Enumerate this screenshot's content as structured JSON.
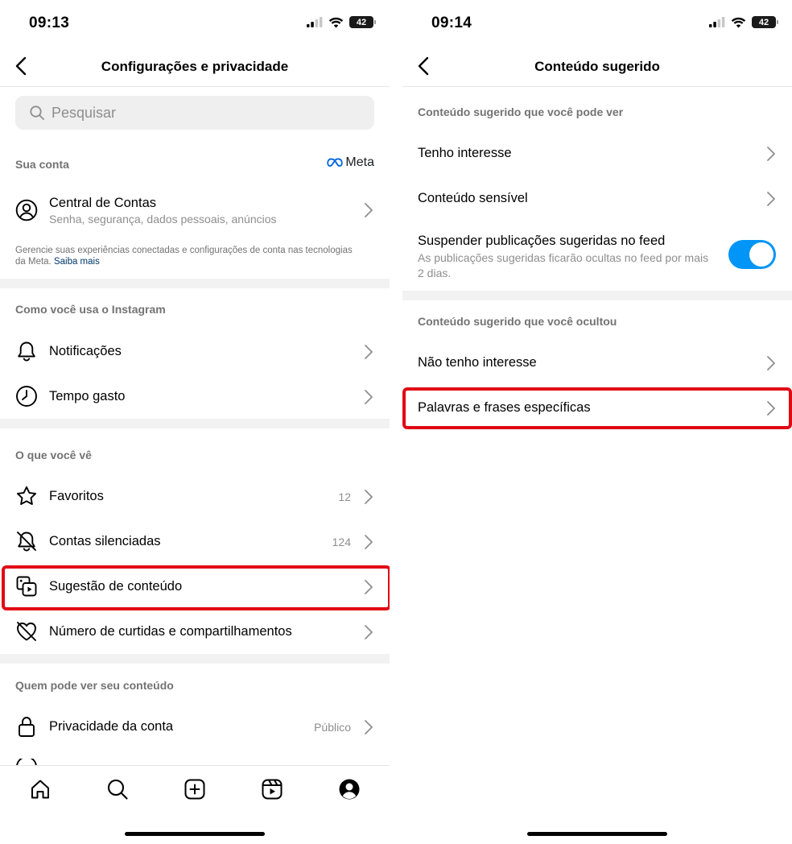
{
  "left": {
    "time": "09:13",
    "battery": "42",
    "header_title": "Configurações e privacidade",
    "search_placeholder": "Pesquisar",
    "section_account": "Sua conta",
    "meta_logo": "Meta",
    "account_center": {
      "title": "Central de Contas",
      "subtitle": "Senha, segurança, dados pessoais, anúncios"
    },
    "info_text": "Gerencie suas experiências conectadas e configurações de conta nas tecnologias da Meta.",
    "info_link": "Saiba mais",
    "section_usage": "Como você usa o Instagram",
    "notifications": "Notificações",
    "time_spent": "Tempo gasto",
    "section_see": "O que você vê",
    "favorites": {
      "label": "Favoritos",
      "count": "12"
    },
    "muted": {
      "label": "Contas silenciadas",
      "count": "124"
    },
    "suggested": "Sugestão de conteúdo",
    "likes_shares": "Número de curtidas e compartilhamentos",
    "section_who": "Quem pode ver seu conteúdo",
    "privacy": {
      "label": "Privacidade da conta",
      "value": "Público"
    }
  },
  "right": {
    "time": "09:14",
    "battery": "42",
    "header_title": "Conteúdo sugerido",
    "section_can_see": "Conteúdo sugerido que você pode ver",
    "interested": "Tenho interesse",
    "sensitive": "Conteúdo sensível",
    "suspend": {
      "title": "Suspender publicações sugeridas no feed",
      "subtitle": "As publicações sugeridas ficarão ocultas no feed por mais 2 dias.",
      "enabled": true
    },
    "section_hidden": "Conteúdo sugerido que você ocultou",
    "not_interested": "Não tenho interesse",
    "specific_words": "Palavras e frases específicas"
  },
  "colors": {
    "toggle_on": "#0095f6",
    "highlight": "#e10914",
    "link": "#00376b"
  }
}
